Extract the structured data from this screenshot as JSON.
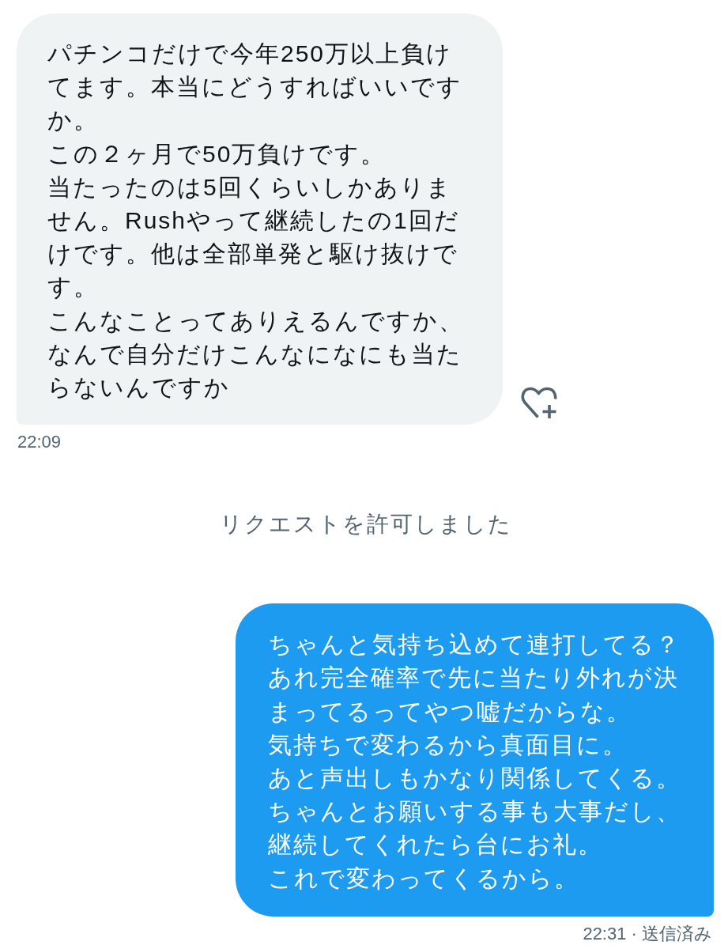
{
  "conversation": {
    "messages": [
      {
        "kind": "received",
        "paragraphs": [
          "パチンコだけで今年250万以上負けてます。本当にどうすればいいですか。",
          "この２ヶ月で50万負けです。",
          "当たったのは5回くらいしかありません。Rushやって継続したの1回だけです。他は全部単発と駆け抜けです。",
          "こんなことってありえるんですか、",
          "なんで自分だけこんなになにも当たらないんですか"
        ],
        "meta": "22:09"
      },
      {
        "kind": "system",
        "text": "リクエストを許可しました"
      },
      {
        "kind": "sent",
        "paragraphs": [
          "ちゃんと気持ち込めて連打してる？",
          "あれ完全確率で先に当たり外れが決まってるってやつ嘘だからな。",
          "気持ちで変わるから真面目に。",
          "あと声出しもかなり関係してくる。",
          "ちゃんとお願いする事も大事だし、",
          "継続してくれたら台にお礼。",
          "これで変わってくるから。"
        ],
        "meta": "22:31 · 送信済み"
      }
    ]
  }
}
